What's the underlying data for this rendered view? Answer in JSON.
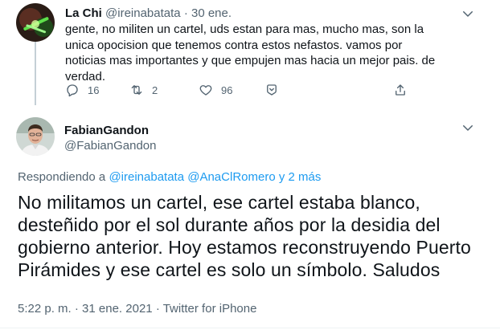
{
  "parent_tweet": {
    "display_name": "La Chi",
    "handle": "@ireinabatata",
    "separator": "·",
    "date": "30 ene.",
    "text": "gente, no militen un cartel, uds estan para mas, mucho mas, son la unica opocision que tenemos contra estos nefastos. vamos por noticias mas importantes y que empujen mas hacia un mejor pais. de verdad.",
    "actions": {
      "reply_icon": "reply-icon",
      "reply_count": "16",
      "retweet_icon": "retweet-icon",
      "retweet_count": "2",
      "like_icon": "heart-icon",
      "like_count": "96",
      "bookmark_icon": "bookmark-icon",
      "share_icon": "share-icon"
    }
  },
  "main_tweet": {
    "display_name": "FabianGandon",
    "handle": "@FabianGandon",
    "replying_prefix": "Respondiendo a",
    "replying_to": [
      "@ireinabatata",
      "@AnaClRomero"
    ],
    "replying_connector": "y",
    "replying_more": "2 más",
    "text": "No militamos un cartel, ese cartel estaba blanco, desteñido por el sol durante años por la desidia del gobierno anterior. Hoy estamos reconstruyendo Puerto Pirámides y ese cartel es solo un símbolo. Saludos",
    "time": "5:22 p. m.",
    "separator": "·",
    "date": "31 ene. 2021",
    "source": "Twitter for iPhone"
  },
  "colors": {
    "text": "#0f1419",
    "muted": "#536471",
    "link": "#1d9bf0",
    "thread_line": "#c4cfd6",
    "divider": "#eff3f4"
  }
}
